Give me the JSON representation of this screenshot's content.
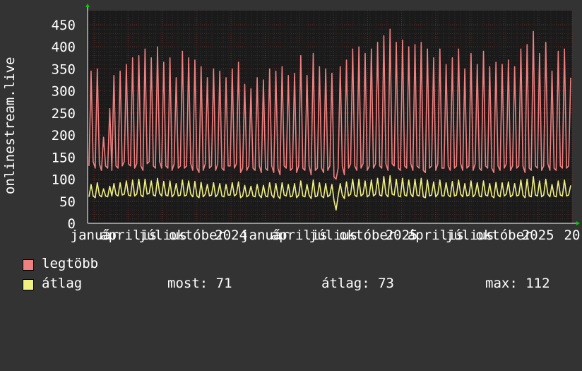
{
  "chart_data": {
    "type": "line",
    "ylabel": "onlinestream.live",
    "ylim": [
      0,
      450
    ],
    "yticks": [
      0,
      50,
      100,
      150,
      200,
      250,
      300,
      350,
      400,
      450
    ],
    "ytick_labels": [
      "0",
      "50",
      "100",
      "150",
      "200",
      "250",
      "300",
      "350",
      "400",
      "450"
    ],
    "xtick_labels": [
      "január",
      "április",
      "július",
      "október",
      "2024",
      "január",
      "április",
      "július",
      "október",
      "2025",
      "április",
      "július",
      "október",
      "2025",
      "20"
    ],
    "x_note": "daily samples spanning roughly 2024 január to 2025 október",
    "grid": true,
    "series": [
      {
        "name": "legtöbb",
        "color": "#f08080",
        "values": [
          130,
          345,
          140,
          125,
          350,
          135,
          120,
          195,
          130,
          125,
          260,
          120,
          335,
          130,
          125,
          345,
          130,
          140,
          360,
          135,
          130,
          375,
          125,
          135,
          380,
          130,
          120,
          395,
          135,
          140,
          375,
          130,
          125,
          400,
          140,
          125,
          365,
          130,
          125,
          375,
          120,
          135,
          330,
          125,
          130,
          390,
          125,
          130,
          375,
          135,
          120,
          370,
          125,
          115,
          355,
          120,
          135,
          330,
          125,
          130,
          350,
          120,
          135,
          345,
          125,
          120,
          330,
          130,
          130,
          350,
          125,
          135,
          365,
          115,
          125,
          315,
          120,
          130,
          305,
          125,
          120,
          330,
          130,
          115,
          325,
          125,
          120,
          350,
          130,
          115,
          345,
          125,
          110,
          355,
          130,
          125,
          335,
          120,
          125,
          340,
          115,
          130,
          380,
          125,
          120,
          335,
          130,
          110,
          385,
          120,
          125,
          355,
          125,
          115,
          350,
          120,
          130,
          340,
          105,
          100,
          125,
          355,
          130,
          110,
          370,
          125,
          135,
          395,
          130,
          120,
          400,
          125,
          135,
          385,
          120,
          130,
          395,
          125,
          135,
          410,
          130,
          125,
          425,
          135,
          120,
          440,
          135,
          130,
          410,
          125,
          120,
          415,
          130,
          125,
          400,
          135,
          120,
          405,
          130,
          125,
          410,
          120,
          115,
          395,
          125,
          130,
          375,
          120,
          135,
          395,
          125,
          125,
          360,
          130,
          120,
          375,
          125,
          130,
          395,
          135,
          120,
          350,
          125,
          130,
          385,
          120,
          135,
          360,
          125,
          120,
          390,
          130,
          125,
          355,
          125,
          115,
          365,
          130,
          120,
          360,
          125,
          135,
          370,
          120,
          130,
          355,
          125,
          130,
          395,
          130,
          115,
          405,
          125,
          120,
          435,
          130,
          125,
          385,
          120,
          130,
          410,
          135,
          120,
          345,
          125,
          120,
          390,
          130,
          125,
          395,
          125,
          130,
          330
        ]
      },
      {
        "name": "átlag",
        "color": "#f0f080",
        "values": [
          60,
          88,
          62,
          58,
          92,
          64,
          60,
          78,
          62,
          60,
          84,
          62,
          90,
          65,
          62,
          92,
          64,
          66,
          96,
          64,
          62,
          98,
          62,
          66,
          100,
          64,
          60,
          100,
          66,
          68,
          96,
          64,
          62,
          102,
          68,
          62,
          95,
          64,
          62,
          96,
          60,
          66,
          90,
          62,
          64,
          98,
          62,
          64,
          96,
          66,
          60,
          95,
          62,
          58,
          93,
          60,
          66,
          88,
          62,
          64,
          92,
          60,
          66,
          90,
          62,
          60,
          88,
          64,
          64,
          92,
          62,
          66,
          94,
          58,
          62,
          86,
          60,
          64,
          84,
          62,
          60,
          88,
          64,
          58,
          86,
          62,
          60,
          92,
          64,
          58,
          90,
          62,
          56,
          92,
          64,
          62,
          88,
          60,
          62,
          90,
          58,
          64,
          96,
          62,
          60,
          88,
          64,
          56,
          98,
          60,
          62,
          92,
          62,
          58,
          90,
          60,
          64,
          88,
          52,
          30,
          62,
          90,
          64,
          56,
          94,
          62,
          66,
          100,
          64,
          60,
          100,
          62,
          66,
          96,
          60,
          64,
          98,
          62,
          66,
          102,
          64,
          62,
          106,
          66,
          60,
          108,
          66,
          64,
          100,
          62,
          60,
          102,
          64,
          62,
          98,
          66,
          60,
          100,
          64,
          62,
          102,
          60,
          58,
          98,
          62,
          64,
          94,
          60,
          66,
          98,
          62,
          62,
          92,
          64,
          60,
          95,
          62,
          64,
          98,
          66,
          60,
          90,
          62,
          64,
          96,
          60,
          66,
          92,
          62,
          60,
          96,
          64,
          62,
          90,
          62,
          58,
          93,
          64,
          60,
          92,
          62,
          66,
          94,
          60,
          64,
          90,
          62,
          64,
          98,
          64,
          58,
          100,
          62,
          60,
          106,
          64,
          62,
          96,
          60,
          64,
          100,
          66,
          60,
          88,
          62,
          60,
          96,
          64,
          62,
          98,
          62,
          64,
          86
        ]
      }
    ]
  },
  "legend": {
    "items": [
      {
        "label": "legtöbb",
        "color": "#f08080"
      },
      {
        "label": "átlag",
        "color": "#f0f080"
      }
    ],
    "stats": {
      "most": "most: 71",
      "atlag": "átlag: 73",
      "max": "max: 112"
    }
  }
}
